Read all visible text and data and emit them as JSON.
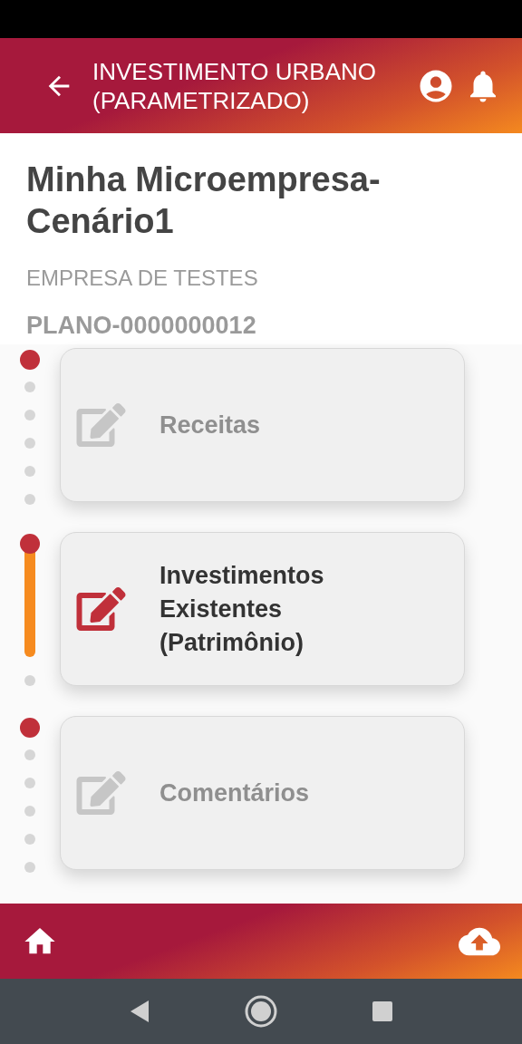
{
  "header": {
    "title": "INVESTIMENTO URBANO (PARAMETRIZADO)"
  },
  "plan": {
    "name": "Minha Microempresa-Cenário1",
    "company": "EMPRESA DE TESTES",
    "code": "PLANO-0000000012"
  },
  "steps": [
    {
      "label": "Receitas",
      "selected": false
    },
    {
      "label": "Investimentos Existentes (Patrimônio)",
      "selected": true
    },
    {
      "label": "Comentários",
      "selected": false
    }
  ]
}
